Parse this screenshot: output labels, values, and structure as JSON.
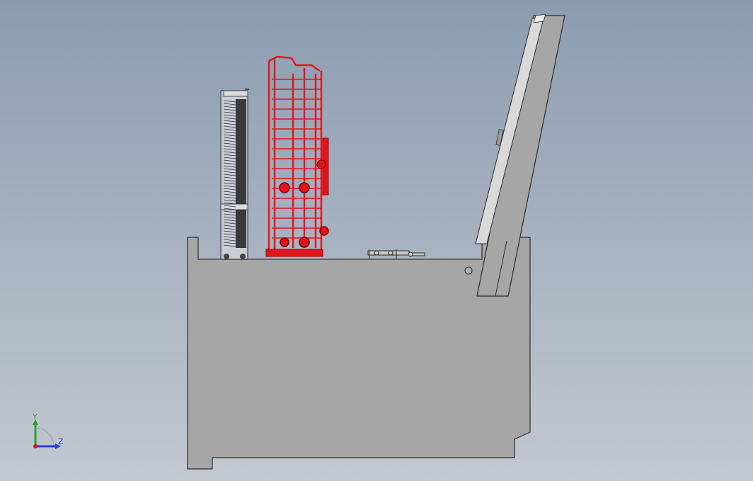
{
  "viewport": {
    "background_top": "#8c9cb0",
    "background_bottom": "#c3c8d1"
  },
  "model": {
    "base_color": "#a6a6a6",
    "edge_color": "#2b2b2b",
    "rack_color": "#e3141c",
    "column_color": "#3a3a3a"
  },
  "triad": {
    "y_label": "Y",
    "z_label": "Z",
    "y_color": "#2ea02e",
    "z_color": "#2442d4",
    "origin_color": "#d01818"
  }
}
